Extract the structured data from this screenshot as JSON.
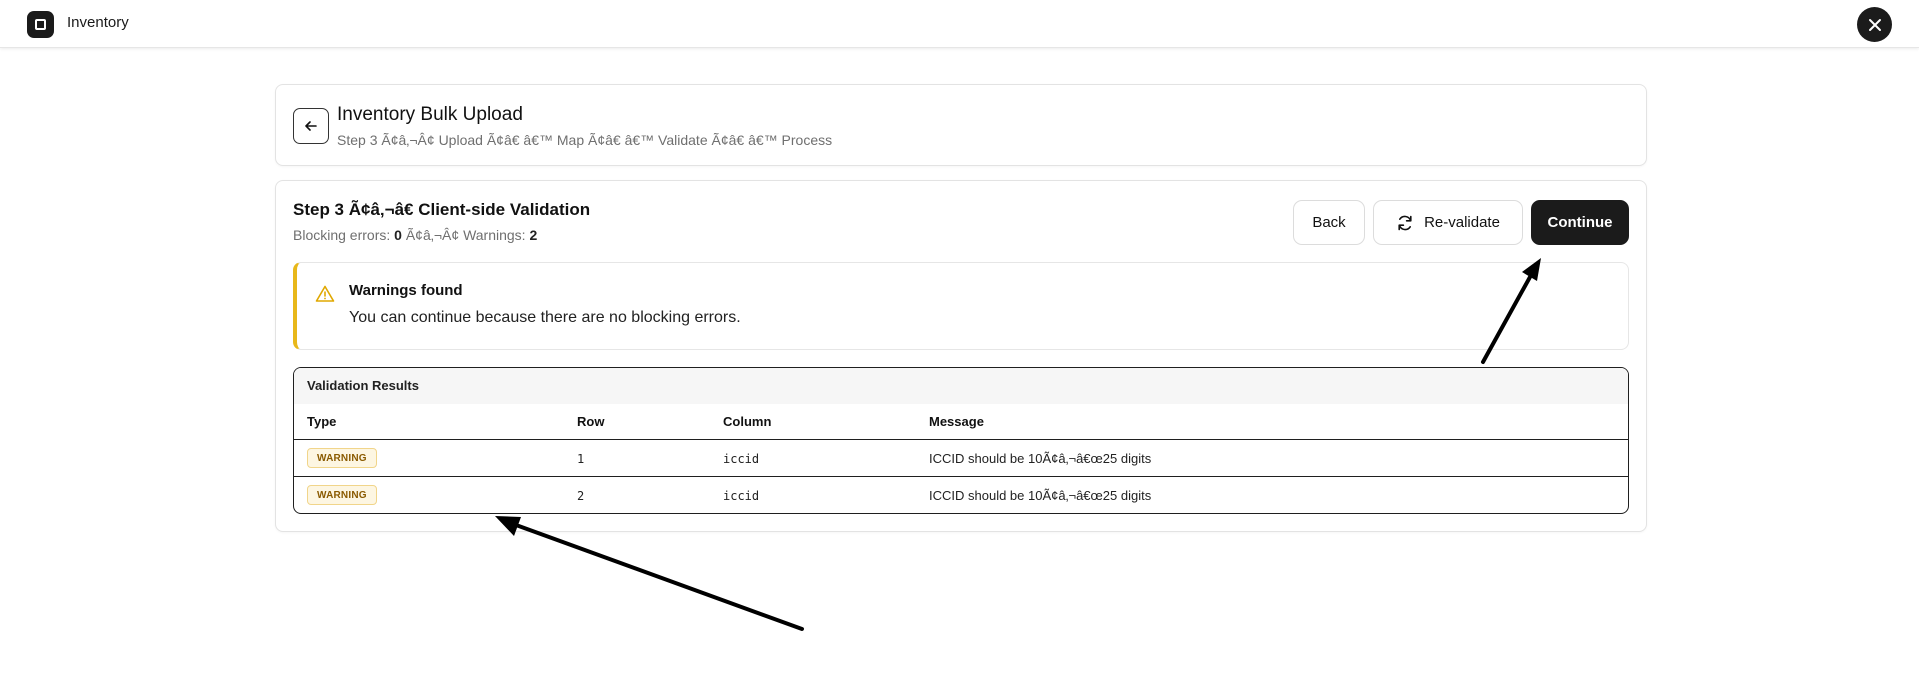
{
  "app": {
    "title": "Inventory",
    "logo_icon": "square-logo-icon",
    "close_icon": "close-icon"
  },
  "header": {
    "back_icon": "arrow-left-icon",
    "title": "Inventory Bulk Upload",
    "subtitle": "Step 3 Ã¢â‚¬Â¢ Upload Ã¢â€ â€™ Map Ã¢â€ â€™ Validate Ã¢â€ â€™ Process"
  },
  "step": {
    "title": "Step 3 Ã¢â‚¬â€ Client-side Validation",
    "blocking_label": "Blocking errors:",
    "blocking_count": "0",
    "separator": "Ã¢â‚¬Â¢",
    "warnings_label": "Warnings:",
    "warnings_count": "2"
  },
  "actions": {
    "back_label": "Back",
    "revalidate_label": "Re-validate",
    "revalidate_icon": "refresh-icon",
    "continue_label": "Continue"
  },
  "alert": {
    "icon": "warning-triangle-icon",
    "title": "Warnings found",
    "text": "You can continue because there are no blocking errors.",
    "accent_color": "#e8b81a"
  },
  "results": {
    "caption": "Validation Results",
    "columns": [
      "Type",
      "Row",
      "Column",
      "Message"
    ],
    "rows": [
      {
        "type": "WARNING",
        "row": "1",
        "column": "iccid",
        "message": "ICCID should be 10Ã¢â‚¬â€œ25 digits"
      },
      {
        "type": "WARNING",
        "row": "2",
        "column": "iccid",
        "message": "ICCID should be 10Ã¢â‚¬â€œ25 digits"
      }
    ]
  }
}
